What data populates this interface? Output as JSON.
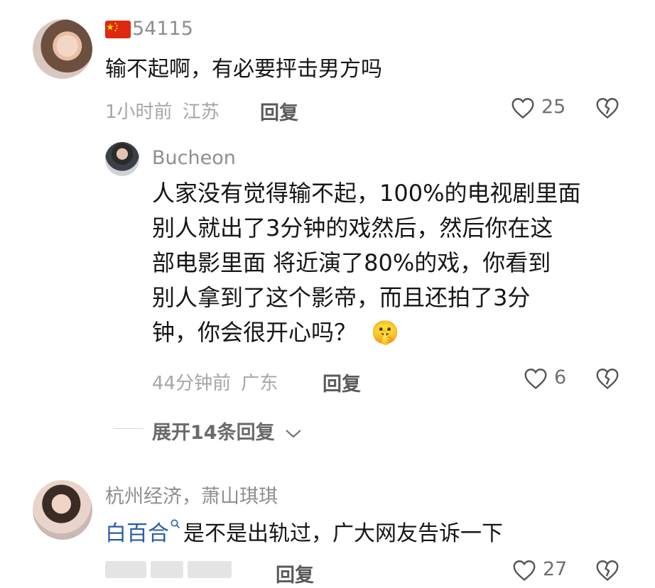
{
  "colors": {
    "text_primary": "#161616",
    "text_secondary": "#a6a6a6",
    "username": "#8e8e8e",
    "link_blue": "#2b5ca8"
  },
  "comments": [
    {
      "flag_icon": "china-flag-icon",
      "username": "54115",
      "text": "输不起啊，有必要抨击男方吗",
      "time": "1小时前",
      "location": "江苏",
      "reply_label": "回复",
      "likes": "25",
      "replies": [
        {
          "username": "Bucheon",
          "text_lines": [
            "人家没有觉得输不起，100%的电视剧里面",
            "别人就出了3分钟的戏然后，然后你在这",
            "部电影里面 将近演了80%的戏，你看到",
            "别人拿到了这个影帝，而且还拍了3分",
            "钟，你会很开心吗？"
          ],
          "emoji": "🤫",
          "time": "44分钟前",
          "location": "广东",
          "reply_label": "回复",
          "likes": "6"
        }
      ],
      "expand_label": "展开14条回复"
    },
    {
      "username": "杭州经济，萧山琪琪",
      "mention": "白百合",
      "text": "是不是出轨过，广大网友告诉一下",
      "reply_label": "回复",
      "likes": "27"
    }
  ]
}
